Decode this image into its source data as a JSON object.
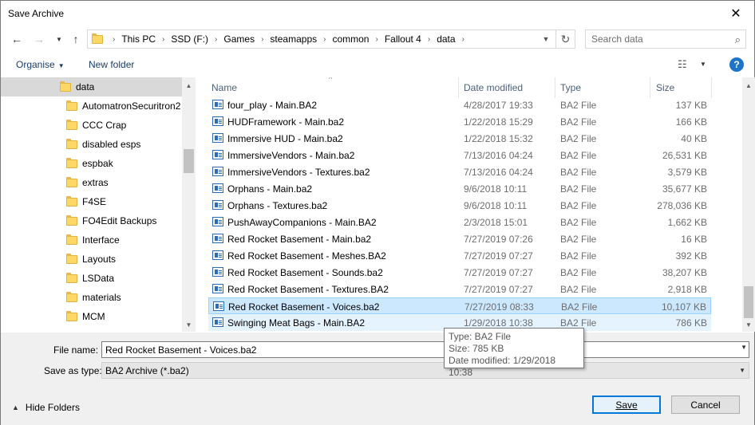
{
  "window": {
    "title": "Save Archive"
  },
  "nav": {
    "breadcrumbs": [
      "This PC",
      "SSD (F:)",
      "Games",
      "steamapps",
      "common",
      "Fallout 4",
      "data"
    ],
    "search_placeholder": "Search data"
  },
  "toolbar": {
    "organise_label": "Organise",
    "new_folder_label": "New folder",
    "help_label": "?"
  },
  "sidebar": {
    "items": [
      {
        "label": "data",
        "selected": true
      },
      {
        "label": "AutomatronSecuritron2",
        "selected": false
      },
      {
        "label": "CCC Crap",
        "selected": false
      },
      {
        "label": "disabled esps",
        "selected": false
      },
      {
        "label": "espbak",
        "selected": false
      },
      {
        "label": "extras",
        "selected": false
      },
      {
        "label": "F4SE",
        "selected": false
      },
      {
        "label": "FO4Edit Backups",
        "selected": false
      },
      {
        "label": "Interface",
        "selected": false
      },
      {
        "label": "Layouts",
        "selected": false
      },
      {
        "label": "LSData",
        "selected": false
      },
      {
        "label": "materials",
        "selected": false
      },
      {
        "label": "MCM",
        "selected": false
      }
    ]
  },
  "filelist": {
    "columns": {
      "name": "Name",
      "date": "Date modified",
      "type": "Type",
      "size": "Size"
    },
    "rows": [
      {
        "name": "four_play - Main.BA2",
        "date": "4/28/2017 19:33",
        "type": "BA2 File",
        "size": "137 KB",
        "state": ""
      },
      {
        "name": "HUDFramework - Main.ba2",
        "date": "1/22/2018 15:29",
        "type": "BA2 File",
        "size": "166 KB",
        "state": ""
      },
      {
        "name": "Immersive HUD - Main.ba2",
        "date": "1/22/2018 15:32",
        "type": "BA2 File",
        "size": "40 KB",
        "state": ""
      },
      {
        "name": "ImmersiveVendors - Main.ba2",
        "date": "7/13/2016 04:24",
        "type": "BA2 File",
        "size": "26,531 KB",
        "state": ""
      },
      {
        "name": "ImmersiveVendors - Textures.ba2",
        "date": "7/13/2016 04:24",
        "type": "BA2 File",
        "size": "3,579 KB",
        "state": ""
      },
      {
        "name": "Orphans - Main.ba2",
        "date": "9/6/2018 10:11",
        "type": "BA2 File",
        "size": "35,677 KB",
        "state": ""
      },
      {
        "name": "Orphans - Textures.ba2",
        "date": "9/6/2018 10:11",
        "type": "BA2 File",
        "size": "278,036 KB",
        "state": ""
      },
      {
        "name": "PushAwayCompanions - Main.BA2",
        "date": "2/3/2018 15:01",
        "type": "BA2 File",
        "size": "1,662 KB",
        "state": ""
      },
      {
        "name": "Red Rocket Basement - Main.ba2",
        "date": "7/27/2019 07:26",
        "type": "BA2 File",
        "size": "16 KB",
        "state": ""
      },
      {
        "name": "Red Rocket Basement - Meshes.BA2",
        "date": "7/27/2019 07:27",
        "type": "BA2 File",
        "size": "392 KB",
        "state": ""
      },
      {
        "name": "Red Rocket Basement - Sounds.ba2",
        "date": "7/27/2019 07:27",
        "type": "BA2 File",
        "size": "38,207 KB",
        "state": ""
      },
      {
        "name": "Red Rocket Basement - Textures.BA2",
        "date": "7/27/2019 07:27",
        "type": "BA2 File",
        "size": "2,918 KB",
        "state": ""
      },
      {
        "name": "Red Rocket Basement - Voices.ba2",
        "date": "7/27/2019 08:33",
        "type": "BA2 File",
        "size": "10,107 KB",
        "state": "selected"
      },
      {
        "name": "Swinging Meat Bags - Main.BA2",
        "date": "1/29/2018 10:38",
        "type": "BA2 File",
        "size": "786 KB",
        "state": "hover"
      }
    ]
  },
  "tooltip": {
    "type_line": "Type: BA2 File",
    "size_line": "Size: 785 KB",
    "date_line": "Date modified: 1/29/2018 10:38"
  },
  "form": {
    "filename_label": "File name:",
    "filename_value": "Red Rocket Basement - Voices.ba2",
    "savetype_label": "Save as type:",
    "savetype_value": "BA2 Archive (*.ba2)"
  },
  "footer": {
    "hide_folders_label": "Hide Folders",
    "save_label": "Save",
    "cancel_label": "Cancel"
  },
  "colors": {
    "accent": "#0078d7",
    "selection": "#cce8ff",
    "hover": "#e5f3ff",
    "help": "#1e74c9"
  }
}
